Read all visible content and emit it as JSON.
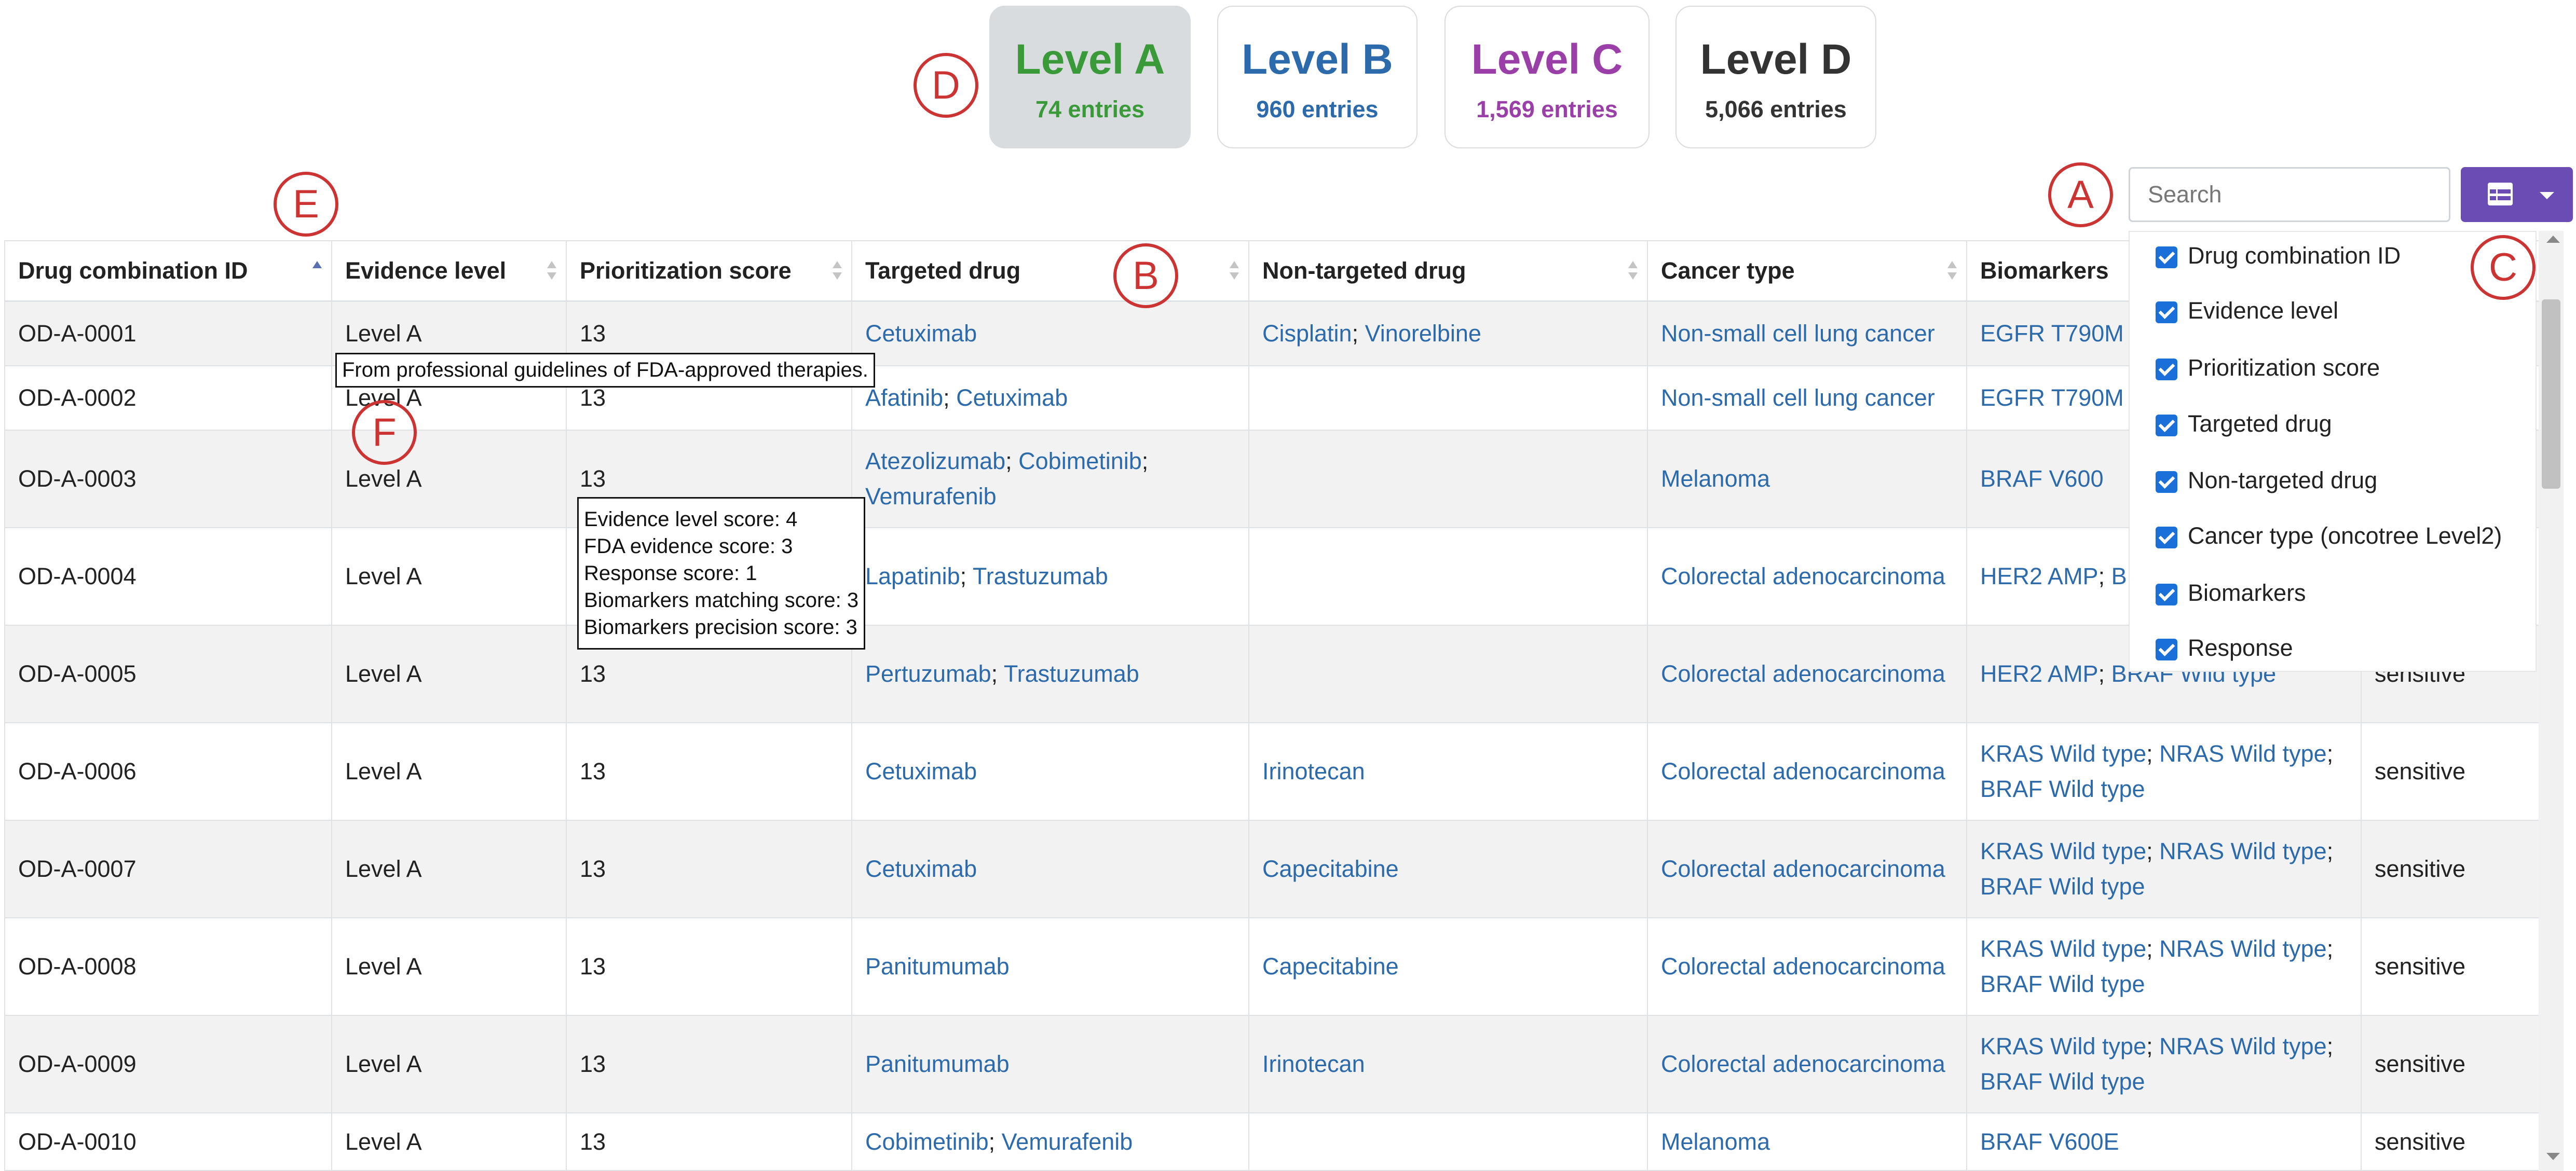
{
  "levels": [
    {
      "title": "Level A",
      "count": "74 entries",
      "color": "#3a9a3a",
      "active": true
    },
    {
      "title": "Level B",
      "count": "960 entries",
      "color": "#2c6aab",
      "active": false
    },
    {
      "title": "Level C",
      "count": "1,569 entries",
      "color": "#9b3fa8",
      "active": false
    },
    {
      "title": "Level D",
      "count": "5,066 entries",
      "color": "#333333",
      "active": false
    }
  ],
  "annotations": {
    "A": "A",
    "B": "B",
    "C": "C",
    "D": "D",
    "E": "E",
    "F": "F"
  },
  "search": {
    "placeholder": "Search"
  },
  "table": {
    "headers": [
      "Drug combination ID",
      "Evidence level",
      "Prioritization score",
      "Targeted drug",
      "Non-targeted drug",
      "Cancer type",
      "Biomarkers",
      ""
    ],
    "rows": [
      {
        "id": "OD-A-0001",
        "level": "Level A",
        "score": "13",
        "targeted": [
          "Cetuximab"
        ],
        "nontargeted": [
          "Cisplatin",
          "Vinorelbine"
        ],
        "cancer": [
          "Non-small cell lung cancer"
        ],
        "biomarkers": [
          "EGFR T790M"
        ],
        "response": ""
      },
      {
        "id": "OD-A-0002",
        "level": "Level A",
        "score": "13",
        "targeted": [
          "Afatinib",
          "Cetuximab"
        ],
        "nontargeted": [],
        "cancer": [
          "Non-small cell lung cancer"
        ],
        "biomarkers": [
          "EGFR T790M"
        ],
        "response": ""
      },
      {
        "id": "OD-A-0003",
        "level": "Level A",
        "score": "13",
        "targeted": [
          "Atezolizumab",
          "Cobimetinib",
          "Vemurafenib"
        ],
        "nontargeted": [],
        "cancer": [
          "Melanoma"
        ],
        "biomarkers": [
          "BRAF V600"
        ],
        "response": ""
      },
      {
        "id": "OD-A-0004",
        "level": "Level A",
        "score": "13",
        "targeted": [
          "Lapatinib",
          "Trastuzumab"
        ],
        "nontargeted": [],
        "cancer": [
          "Colorectal adenocarcinoma"
        ],
        "biomarkers": [
          "HER2 AMP",
          "BRAF Wild type"
        ],
        "response": ""
      },
      {
        "id": "OD-A-0005",
        "level": "Level A",
        "score": "13",
        "targeted": [
          "Pertuzumab",
          "Trastuzumab"
        ],
        "nontargeted": [],
        "cancer": [
          "Colorectal adenocarcinoma"
        ],
        "biomarkers": [
          "HER2 AMP",
          "BRAF Wild type"
        ],
        "response": "sensitive"
      },
      {
        "id": "OD-A-0006",
        "level": "Level A",
        "score": "13",
        "targeted": [
          "Cetuximab"
        ],
        "nontargeted": [
          "Irinotecan"
        ],
        "cancer": [
          "Colorectal adenocarcinoma"
        ],
        "biomarkers": [
          "KRAS Wild type",
          "NRAS Wild type",
          "BRAF Wild type"
        ],
        "response": "sensitive"
      },
      {
        "id": "OD-A-0007",
        "level": "Level A",
        "score": "13",
        "targeted": [
          "Cetuximab"
        ],
        "nontargeted": [
          "Capecitabine"
        ],
        "cancer": [
          "Colorectal adenocarcinoma"
        ],
        "biomarkers": [
          "KRAS Wild type",
          "NRAS Wild type",
          "BRAF Wild type"
        ],
        "response": "sensitive"
      },
      {
        "id": "OD-A-0008",
        "level": "Level A",
        "score": "13",
        "targeted": [
          "Panitumumab"
        ],
        "nontargeted": [
          "Capecitabine"
        ],
        "cancer": [
          "Colorectal adenocarcinoma"
        ],
        "biomarkers": [
          "KRAS Wild type",
          "NRAS Wild type",
          "BRAF Wild type"
        ],
        "response": "sensitive"
      },
      {
        "id": "OD-A-0009",
        "level": "Level A",
        "score": "13",
        "targeted": [
          "Panitumumab"
        ],
        "nontargeted": [
          "Irinotecan"
        ],
        "cancer": [
          "Colorectal adenocarcinoma"
        ],
        "biomarkers": [
          "KRAS Wild type",
          "NRAS Wild type",
          "BRAF Wild type"
        ],
        "response": "sensitive"
      },
      {
        "id": "OD-A-0010",
        "level": "Level A",
        "score": "13",
        "targeted": [
          "Cobimetinib",
          "Vemurafenib"
        ],
        "nontargeted": [],
        "cancer": [
          "Melanoma"
        ],
        "biomarkers": [
          "BRAF V600E"
        ],
        "response": "sensitive"
      }
    ]
  },
  "tooltips": {
    "evidence": "From professional guidelines of FDA-approved therapies.",
    "score_lines": [
      "Evidence level score: 4",
      "FDA evidence score: 3",
      "Response score: 1",
      "Biomarkers matching score: 3",
      "Biomarkers precision score: 3"
    ]
  },
  "column_menu": {
    "items": [
      "Drug combination ID",
      "Evidence level",
      "Prioritization score",
      "Targeted drug",
      "Non-targeted drug",
      "Cancer type (oncotree Level2)",
      "Biomarkers",
      "Response"
    ]
  },
  "colors": {
    "accent_button": "#6b4bb4",
    "link": "#2c6aab",
    "annotation": "#cc3333",
    "checkbox": "#1a6fd8"
  },
  "icons": {
    "columns_button": "table-grid-icon",
    "dropdown": "caret-down-icon"
  }
}
